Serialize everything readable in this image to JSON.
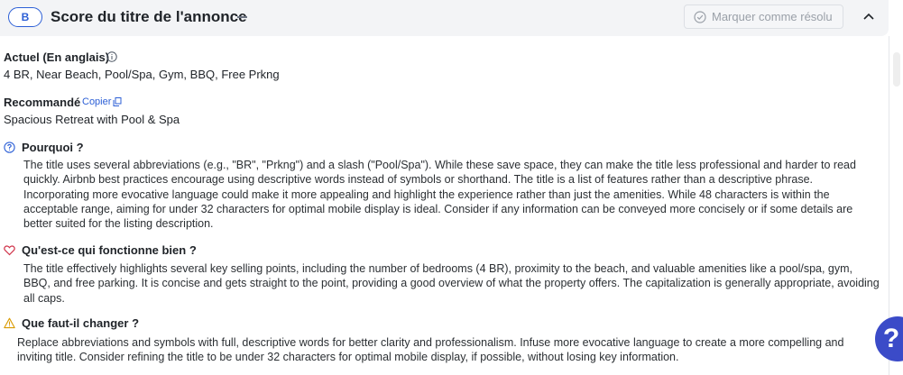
{
  "header": {
    "grade": "B",
    "title": "Score du titre de l'annonce",
    "resolve_label": "Marquer comme résolu"
  },
  "current": {
    "label": "Actuel (En anglais)",
    "value": "4 BR, Near Beach, Pool/Spa, Gym, BBQ, Free Prkng"
  },
  "recommended": {
    "label": "Recommandé",
    "copy_label": "Copier",
    "value": "Spacious Retreat with Pool & Spa"
  },
  "why": {
    "title": "Pourquoi ?",
    "lines": [
      "The title uses several abbreviations (e.g., \"BR\", \"Prkng\") and a slash (\"Pool/Spa\"). While these save space, they can make the title less professional and harder to read",
      "quickly. Airbnb best practices encourage using descriptive words instead of symbols or shorthand. The title is a list of features rather than a descriptive phrase.",
      "Incorporating more evocative language could make it more appealing and highlight the experience rather than just the amenities. While 48 characters is within the",
      "acceptable range, aiming for under 32 characters for optimal mobile display is ideal. Consider if any information can be conveyed more concisely or if some details are",
      "better suited for the listing description."
    ]
  },
  "works": {
    "title": "Qu'est-ce qui fonctionne bien ?",
    "lines": [
      "The title effectively highlights several key selling points, including the number of bedrooms (4 BR), proximity to the beach, and valuable amenities like a pool/spa, gym,",
      "BBQ, and free parking. It is concise and gets straight to the point, providing a good overview of what the property offers. The capitalization is generally appropriate, avoiding",
      "all caps."
    ]
  },
  "change": {
    "title": "Que faut-il changer ?",
    "lines": [
      "Replace abbreviations and symbols with full, descriptive words for better clarity and professionalism. Infuse more evocative language to create a more compelling and",
      "inviting title. Consider refining the title to be under 32 characters for optimal mobile display, if possible, without losing key information."
    ]
  },
  "help": {
    "symbol": "?"
  },
  "colors": {
    "accent_blue": "#2c5fd6",
    "heart_red": "#d0334a",
    "warning_amber": "#d99a00",
    "help_fab": "#3b4bc8"
  }
}
